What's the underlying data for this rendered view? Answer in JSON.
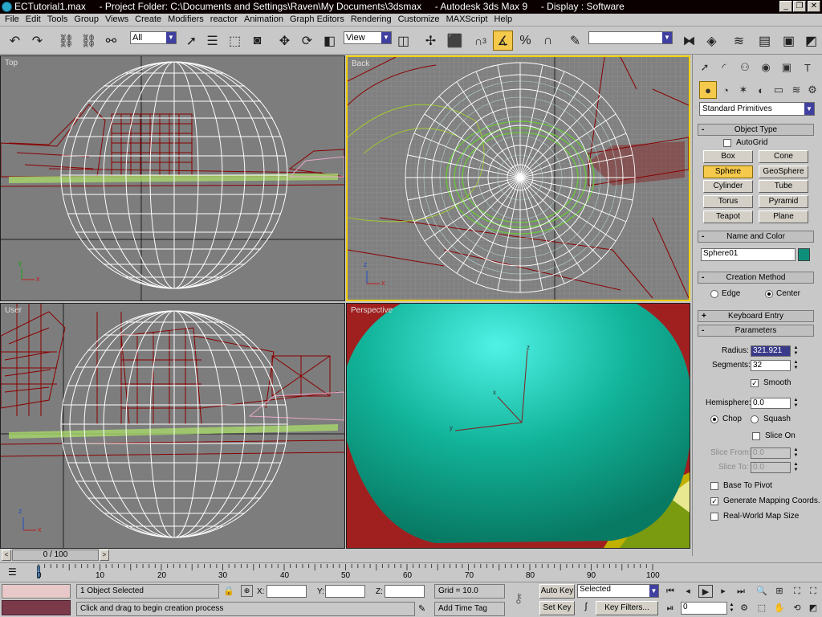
{
  "window": {
    "title": "ECTutorial1.max     - Project Folder: C:\\Documents and Settings\\Raven\\My Documents\\3dsmax     - Autodesk 3ds Max 9     - Display : Software",
    "controls": [
      "_",
      "❐",
      "✕"
    ]
  },
  "menu": [
    "File",
    "Edit",
    "Tools",
    "Group",
    "Views",
    "Create",
    "Modifiers",
    "reactor",
    "Animation",
    "Graph Editors",
    "Rendering",
    "Customize",
    "MAXScript",
    "Help"
  ],
  "toolbar": {
    "selection_filter": "All",
    "reference_coord": "View",
    "snap_label": "3",
    "named_selection": ""
  },
  "viewports": {
    "top": "Top",
    "back": "Back",
    "user": "User",
    "perspective": "Perspective",
    "axis_x": "x",
    "axis_y": "y",
    "axis_z": "z"
  },
  "command_panel": {
    "category": "Standard Primitives",
    "object_type": {
      "title": "Object Type",
      "autogrid": "AutoGrid",
      "buttons": [
        "Box",
        "Cone",
        "Sphere",
        "GeoSphere",
        "Cylinder",
        "Tube",
        "Torus",
        "Pyramid",
        "Teapot",
        "Plane"
      ],
      "active": "Sphere"
    },
    "name_color": {
      "title": "Name and Color",
      "name": "Sphere01",
      "color": "#0e8f7a"
    },
    "creation_method": {
      "title": "Creation Method",
      "edge": "Edge",
      "center": "Center"
    },
    "keyboard_entry": "Keyboard Entry",
    "parameters": {
      "title": "Parameters",
      "radius_label": "Radius:",
      "radius": "321.921",
      "segments_label": "Segments:",
      "segments": "32",
      "smooth": "Smooth",
      "hemisphere_label": "Hemisphere:",
      "hemisphere": "0.0",
      "chop": "Chop",
      "squash": "Squash",
      "slice_on": "Slice On",
      "slice_from_label": "Slice From:",
      "slice_from": "0.0",
      "slice_to_label": "Slice To:",
      "slice_to": "0.0",
      "base_to_pivot": "Base To Pivot",
      "gen_mapping": "Generate Mapping Coords.",
      "real_world": "Real-World Map Size"
    }
  },
  "timeline": {
    "frame": "0 / 100",
    "ticks": [
      "0",
      "10",
      "20",
      "30",
      "40",
      "50",
      "60",
      "70",
      "80",
      "90",
      "100"
    ]
  },
  "status": {
    "selected": "1 Object Selected",
    "prompt": "Click and drag to begin creation process",
    "x_label": "X:",
    "y_label": "Y:",
    "z_label": "Z:",
    "grid": "Grid = 10.0",
    "add_time_tag": "Add Time Tag",
    "auto_key": "Auto Key",
    "set_key": "Set Key",
    "key_mode": "Selected",
    "key_filters": "Key Filters...",
    "current_frame": "0"
  }
}
